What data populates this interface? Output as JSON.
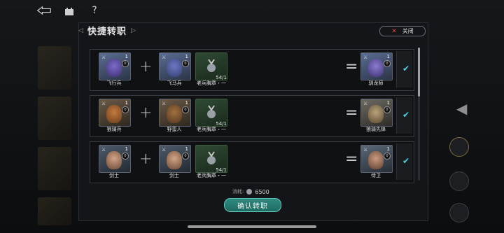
{
  "header": {
    "help_label": "?"
  },
  "dialog": {
    "title": "快捷转职",
    "close_label": "关闭"
  },
  "rows": [
    {
      "input1": {
        "name": "飞行兵",
        "level": "1",
        "badge": "0"
      },
      "input2": {
        "name": "飞马兵",
        "level": "1",
        "badge": "0"
      },
      "material": {
        "name": "老兵胸章・一",
        "count": "54/1"
      },
      "result": {
        "name": "驯龙师",
        "level": "1",
        "badge": "0"
      },
      "plus": "+",
      "equals": "="
    },
    {
      "input1": {
        "name": "狼骑兵",
        "level": "1",
        "badge": "0"
      },
      "input2": {
        "name": "野蛮人",
        "level": "1",
        "badge": "0"
      },
      "material": {
        "name": "老兵胸章・一",
        "count": "54/1"
      },
      "result": {
        "name": "狼骑先锋",
        "level": "1",
        "badge": "0"
      },
      "plus": "+",
      "equals": "="
    },
    {
      "input1": {
        "name": "剑士",
        "level": "1",
        "badge": "0"
      },
      "input2": {
        "name": "剑士",
        "level": "1",
        "badge": "0"
      },
      "material": {
        "name": "老兵胸章・一",
        "count": "54/1"
      },
      "result": {
        "name": "侍卫",
        "level": "1",
        "badge": "0"
      },
      "plus": "+",
      "equals": "="
    }
  ],
  "footer": {
    "cost_label": "消耗:",
    "cost_value": "6500",
    "confirm_label": "确认转职"
  },
  "colors": {
    "accent": "#4ad1e6",
    "confirm": "#2e8b80",
    "close_x": "#e04a3a"
  }
}
